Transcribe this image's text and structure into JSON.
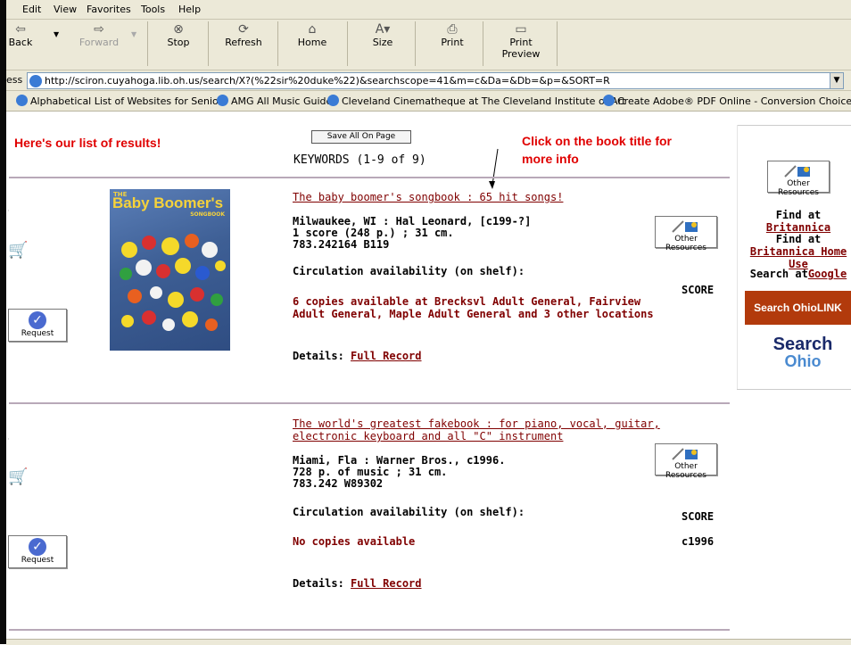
{
  "menu": [
    "Edit",
    "View",
    "Favorites",
    "Tools",
    "Help"
  ],
  "toolbar": {
    "back": "Back",
    "forward": "Forward",
    "stop": "Stop",
    "refresh": "Refresh",
    "home": "Home",
    "size": "Size",
    "print": "Print",
    "print_preview": "Print Preview"
  },
  "address": {
    "label": "ess",
    "url": "http://sciron.cuyahoga.lib.oh.us/search/X?(%22sir%20duke%22)&searchscope=41&m=c&Da=&Db=&p=&SORT=R"
  },
  "links": [
    "Alphabetical List of Websites for Seniors",
    "AMG All Music Guide",
    "Cleveland Cinematheque at The Cleveland Institute of Art",
    "Create Adobe® PDF Online - Conversion Choices"
  ],
  "annotations": {
    "left": "Here's our list of results!",
    "right_line1": "Click on the book title for",
    "right_line2": "more info"
  },
  "save_all": "Save All On Page",
  "keywords": "KEYWORDS (1-9 of 9)",
  "other_resources": "Other Resources",
  "request": "Request",
  "sidebar": {
    "find_at": "Find at ",
    "britannica": "Britannica",
    "britannica_home_use": "Britannica Home Use",
    "search_at": "Search at",
    "google": "Google",
    "search_ohiolink": "Search OhioLINK",
    "search_ohio_1": "Search",
    "search_ohio_2": "Ohio"
  },
  "results": [
    {
      "title": "The baby boomer's songbook : 65 hit songs!",
      "title_line2": "",
      "pub": "Milwaukee, WI : Hal Leonard, [c199-?]",
      "desc": "1 score (248 p.) ; 31 cm.",
      "call": "783.242164 B119",
      "circ": "Circulation availability (on shelf):",
      "avail1": "6 copies available at Brecksvl Adult General, Fairview",
      "avail2": "Adult General, Maple Adult General and 3 other locations",
      "format": "SCORE",
      "date": "",
      "details_label": "Details: ",
      "details_link": "Full Record",
      "cover_title": "Baby Boomer's",
      "cover_sub": "SONGBOOK",
      "cover_the": "THE"
    },
    {
      "title": "The world's greatest fakebook : for piano, vocal, guitar,",
      "title_line2": "electronic keyboard and all \"C\" instrument",
      "pub": "Miami, Fla : Warner Bros., c1996.",
      "desc": "728 p. of music ; 31 cm.",
      "call": "783.242 W89302",
      "circ": "Circulation availability (on shelf):",
      "avail1": "No copies available",
      "avail2": "",
      "format": "SCORE",
      "date": "c1996",
      "details_label": "Details: ",
      "details_link": "Full Record"
    }
  ]
}
